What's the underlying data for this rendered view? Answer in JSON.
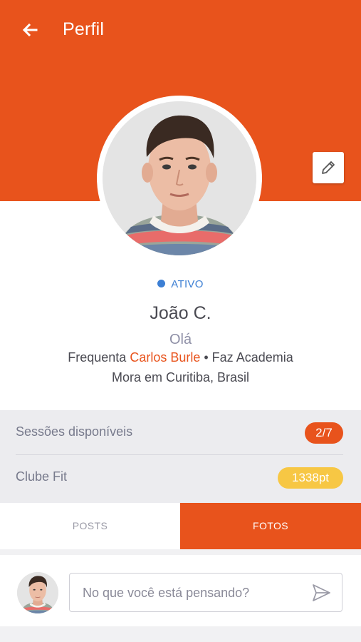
{
  "header": {
    "title": "Perfil",
    "back_icon": "arrow-left-icon",
    "edit_icon": "pencil-icon",
    "color": "#e8531c"
  },
  "profile": {
    "status": "ATIVO",
    "status_color": "#3c7fd4",
    "name": "João C.",
    "greeting": "Olá",
    "frequents_prefix": "Frequenta ",
    "coach": "Carlos Burle",
    "frequents_suffix": " • Faz Academia",
    "location": "Mora em Curitiba, Brasil"
  },
  "stats": {
    "sessions_label": "Sessões disponíveis",
    "sessions_value": "2/7",
    "club_label": "Clube Fit",
    "club_value": "1338pt",
    "club_color": "#f7c744"
  },
  "tabs": {
    "posts": "POSTS",
    "fotos": "FOTOS",
    "active": "FOTOS"
  },
  "compose": {
    "placeholder": "No que você está pensando?",
    "send_icon": "send-icon"
  }
}
